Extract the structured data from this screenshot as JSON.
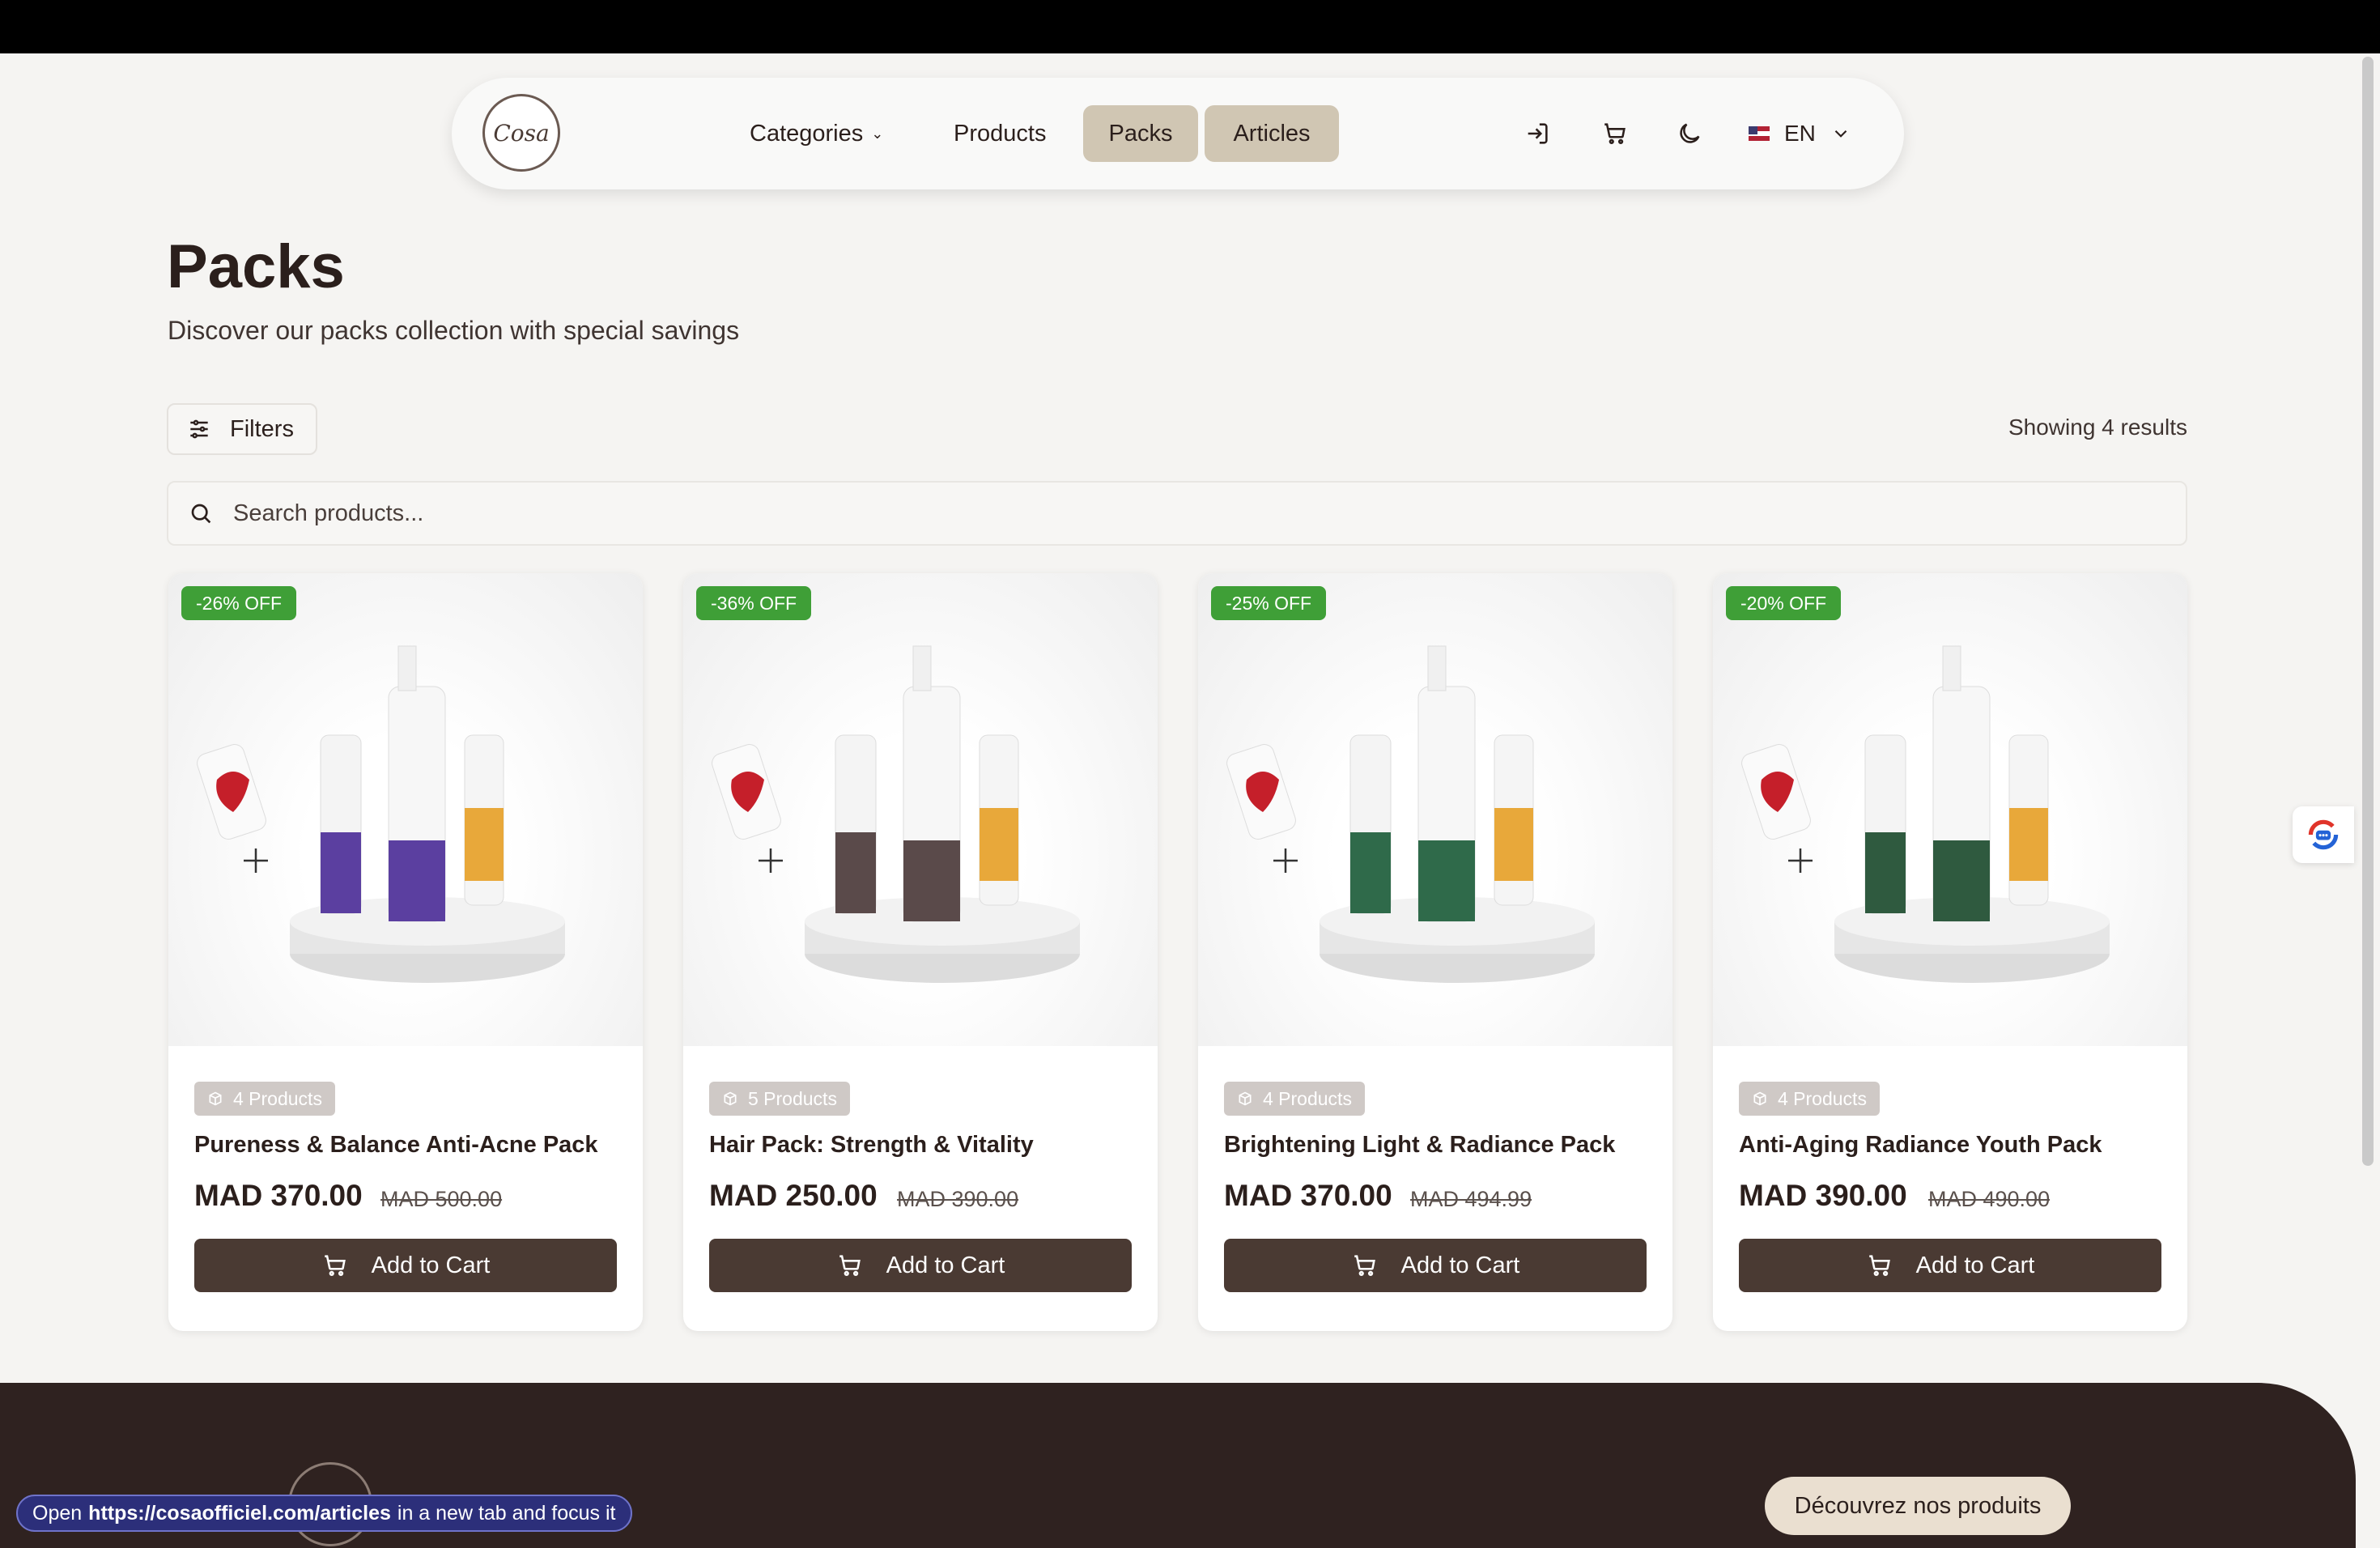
{
  "nav": {
    "logo_text": "Cosa",
    "items": [
      {
        "label": "Categories"
      },
      {
        "label": "Products"
      },
      {
        "label": "Packs"
      },
      {
        "label": "Articles"
      }
    ],
    "language": "EN"
  },
  "page": {
    "title": "Packs",
    "subtitle": "Discover our packs collection with special savings"
  },
  "toolbar": {
    "filters_label": "Filters",
    "results_text": "Showing 4 results"
  },
  "search": {
    "placeholder": "Search products..."
  },
  "packs": [
    {
      "discount": "-26% OFF",
      "count": "4 Products",
      "name": "Pureness & Balance Anti-Acne Pack",
      "price": "MAD 370.00",
      "old_price": "MAD 500.00",
      "cta": "Add to Cart",
      "accent": "#5b3fa0"
    },
    {
      "discount": "-36% OFF",
      "count": "5 Products",
      "name": "Hair Pack: Strength & Vitality",
      "price": "MAD 250.00",
      "old_price": "MAD 390.00",
      "cta": "Add to Cart",
      "accent": "#5a4a4a"
    },
    {
      "discount": "-25% OFF",
      "count": "4 Products",
      "name": "Brightening Light & Radiance Pack",
      "price": "MAD 370.00",
      "old_price": "MAD 494.99",
      "cta": "Add to Cart",
      "accent": "#2f6a4a"
    },
    {
      "discount": "-20% OFF",
      "count": "4 Products",
      "name": "Anti-Aging Radiance Youth Pack",
      "price": "MAD 390.00",
      "old_price": "MAD 490.00",
      "cta": "Add to Cart",
      "accent": "#2f5a3f"
    }
  ],
  "footer": {
    "cta_label": "Découvrez nos produits"
  },
  "status_tip": {
    "prefix": "Open",
    "url": "https://cosaofficiel.com/articles",
    "suffix": "in a new tab and focus it"
  },
  "colors": {
    "accent_green": "#3f9f37",
    "button_brown": "#4a3a33",
    "nav_active": "#d0c6b3"
  }
}
